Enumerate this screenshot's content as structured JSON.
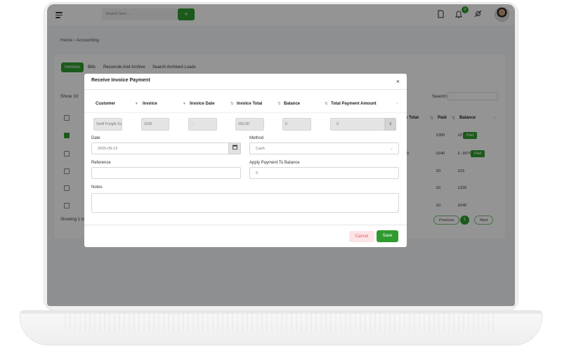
{
  "topbar": {
    "search_placeholder": "Search here...",
    "search_button": "+",
    "notification_count": "0"
  },
  "breadcrumb": "Home  ›  Accounting",
  "tabs": [
    "Invoices",
    "Bills",
    "Reconcile And Archive",
    "Search Archived Loads"
  ],
  "background_table": {
    "show_label": "Show",
    "show_value": "10",
    "search_label": "Search:",
    "headers": [
      "e Total",
      "Paid",
      "Balance"
    ],
    "rows": [
      {
        "total": "",
        "paid": "£350",
        "balance": "£0",
        "status": "Paid"
      },
      {
        "total": "0",
        "paid": "£640",
        "balance": "£ -3570",
        "status": "Paid"
      },
      {
        "total": "",
        "paid": "£0",
        "balance": "£15",
        "status": ""
      },
      {
        "total": "",
        "paid": "£0",
        "balance": "£326",
        "status": ""
      },
      {
        "total": "",
        "paid": "£0",
        "balance": "£640",
        "status": ""
      }
    ],
    "footer_text": "Showing 1 to",
    "previous": "Previous",
    "page": "1",
    "next": "Next"
  },
  "modal": {
    "title": "Receive Invoice Payment",
    "close": "×",
    "columns": [
      "Customer",
      "Invoice",
      "Invoice Date",
      "Invoice Total",
      "Balance",
      "Total Payment Amount"
    ],
    "row": {
      "customer": "Swift Freight So",
      "invoice": "1535",
      "invoice_date": "...",
      "invoice_total": "350.00",
      "balance": "0",
      "payment_amount": "0",
      "currency": "£"
    },
    "date_label": "Date",
    "date_value": "2025-09-13",
    "method_label": "Method",
    "method_value": "Cash",
    "reference_label": "Reference",
    "reference_value": "",
    "apply_label": "Apply Payment To Balance",
    "apply_value": "0",
    "notes_label": "Notes",
    "notes_value": "",
    "cancel": "Cancel",
    "save": "Save"
  }
}
